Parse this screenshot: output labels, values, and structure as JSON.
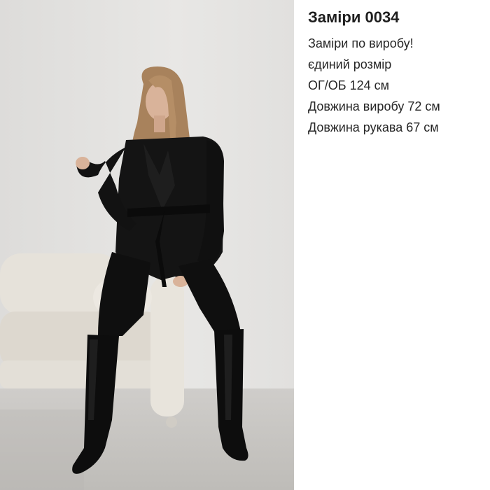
{
  "panel": {
    "title": "Заміри 0034",
    "lines": [
      "Заміри по виробу!",
      "єдиний розмір",
      "ОГ/ОБ 124 см",
      "Довжина виробу  72 см",
      "Довжина рукава 67 см"
    ]
  },
  "photo": {
    "subject": "model-in-black-belted-blazer",
    "colors": {
      "wall": "#e4e3e1",
      "floor": "#c9c7c3",
      "sofa": "#e6e2da",
      "outfit": "#141414",
      "hair": "#a8825c",
      "skin": "#d9b39a"
    }
  }
}
